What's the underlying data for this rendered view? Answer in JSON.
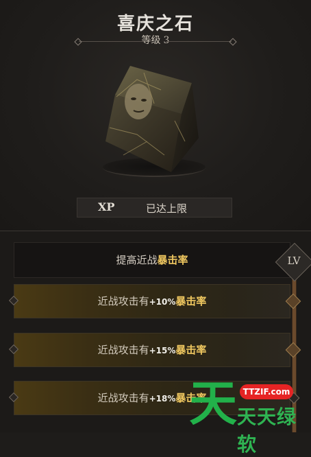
{
  "item": {
    "title": "喜庆之石",
    "level_label": "等级",
    "level_value": "3"
  },
  "xp": {
    "label": "XP",
    "status": "已达上限"
  },
  "panel": {
    "lv_badge": "LV",
    "header": {
      "prefix": "提高近战",
      "highlight": "暴击率"
    },
    "tiers": [
      {
        "prefix": "近战攻击有",
        "value": "+10%",
        "highlight": "暴击率"
      },
      {
        "prefix": "近战攻击有",
        "value": "+15%",
        "highlight": "暴击率"
      },
      {
        "prefix": "近战攻击有",
        "value": "+18%",
        "highlight": "暴击率"
      }
    ]
  },
  "watermark": {
    "big_char": "天",
    "badge": "TTZIF.com",
    "text": "天天绿软"
  },
  "colors": {
    "highlight": "#f0c860",
    "tier_fill": "#4a3a14",
    "track": "#6b4a2c",
    "watermark_green": "#22b14a",
    "watermark_red": "#e62424"
  }
}
